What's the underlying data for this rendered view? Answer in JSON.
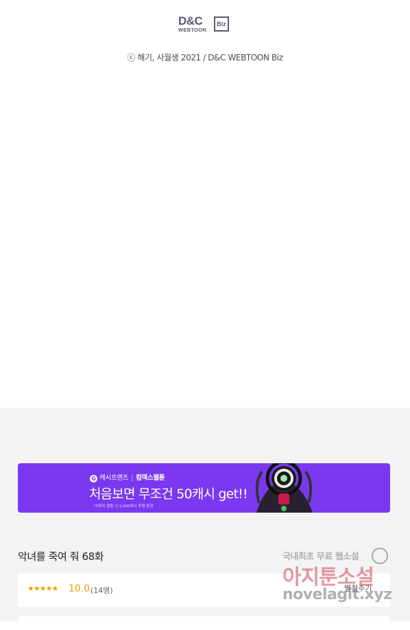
{
  "publisher_logo": {
    "main": "D&C",
    "sub": "WEBTOON",
    "badge": "Biz"
  },
  "copyright": "ⓒ 해기, 사월생 2021 / D&C WEBTOON Biz",
  "ad_banner": {
    "brand_icon": "G",
    "brand_left": "캐시프렌즈",
    "brand_right": "컴덱스웹툰",
    "headline": "처음보면 무조건 50캐시 get!!",
    "fine_print": "*5화자 열람 시 1,000캐시 추첨 증정",
    "accent_color": "#7a38f0"
  },
  "episode": {
    "title": "악녀를 죽여 줘 68화"
  },
  "rating": {
    "stars": "★★★★★",
    "score": "10.0",
    "count": "(14명)",
    "rate_button": "별점주기",
    "star_color": "#e8a200"
  },
  "watermark": {
    "line1": "국내최초 무료 웹소설",
    "line2": "아지툰소설",
    "line3": "novelagit.xyz"
  }
}
